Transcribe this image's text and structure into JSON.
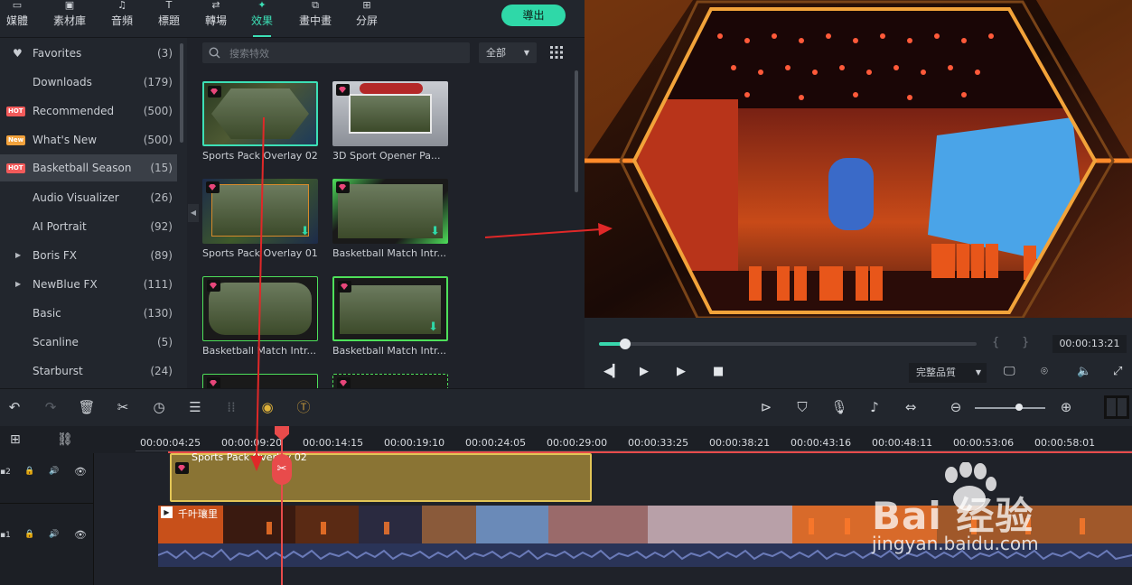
{
  "top_tabs": [
    {
      "label": "媒體",
      "icon": "media-icon"
    },
    {
      "label": "素材庫",
      "icon": "stock-icon"
    },
    {
      "label": "音頻",
      "icon": "audio-icon"
    },
    {
      "label": "標題",
      "icon": "title-icon"
    },
    {
      "label": "轉場",
      "icon": "transition-icon"
    },
    {
      "label": "效果",
      "icon": "effects-icon",
      "active": true
    },
    {
      "label": "畫中畫",
      "icon": "pip-icon"
    },
    {
      "label": "分屏",
      "icon": "split-screen-icon"
    }
  ],
  "export_label": "導出",
  "categories": [
    {
      "label": "Favorites",
      "count": "(3)",
      "icon": "heart-icon"
    },
    {
      "label": "Downloads",
      "count": "(179)"
    },
    {
      "label": "Recommended",
      "count": "(500)",
      "badge": "HOT"
    },
    {
      "label": "What's New",
      "count": "(500)",
      "badge": "New"
    },
    {
      "label": "Basketball Season",
      "count": "(15)",
      "badge": "HOT",
      "selected": true
    },
    {
      "label": "Audio Visualizer",
      "count": "(26)"
    },
    {
      "label": "AI Portrait",
      "count": "(92)"
    },
    {
      "label": "Boris FX",
      "count": "(89)",
      "expandable": true
    },
    {
      "label": "NewBlue FX",
      "count": "(111)",
      "expandable": true
    },
    {
      "label": "Basic",
      "count": "(130)"
    },
    {
      "label": "Scanline",
      "count": "(5)"
    },
    {
      "label": "Starburst",
      "count": "(24)"
    }
  ],
  "search": {
    "placeholder": "搜索特效"
  },
  "filter": {
    "value": "全部"
  },
  "effects": [
    {
      "label": "Sports Pack Overlay 02",
      "selected": true
    },
    {
      "label": "3D Sport Opener Pa..."
    },
    {
      "label": "Sports Pack Overlay 01",
      "downloadable": true
    },
    {
      "label": "Basketball Match Intr...",
      "downloadable": true
    },
    {
      "label": "Basketball Match Intr..."
    },
    {
      "label": "Basketball Match Intr...",
      "downloadable": true
    }
  ],
  "player": {
    "timecode": "00:00:13:21",
    "quality": "完整品質",
    "progress_fraction": 0.07,
    "bracket_in": "{",
    "bracket_out": "}"
  },
  "ruler_ticks": [
    "00:00:04:25",
    "00:00:09:20",
    "00:00:14:15",
    "00:00:19:10",
    "00:00:24:05",
    "00:00:29:00",
    "00:00:33:25",
    "00:00:38:21",
    "00:00:43:16",
    "00:00:48:11",
    "00:00:53:06",
    "00:00:58:01"
  ],
  "tracks": {
    "track2_num": "2",
    "track1_num": "1",
    "clip2_name": "Sports Pack Overlay 02",
    "clip1_name": "千叶瓖里"
  },
  "watermark": {
    "brand": "Bai 经验",
    "url": "jingyan.baidu.com"
  },
  "colors": {
    "accent": "#2fd8a8",
    "playhead": "#e84b4b",
    "effect_clip": "#8a7434",
    "effect_clip_border": "#e2c556",
    "video_clip": "#2c3e66"
  }
}
